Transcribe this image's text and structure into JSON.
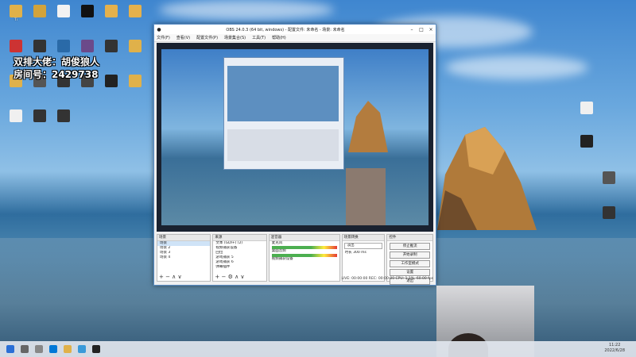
{
  "overlay": {
    "line1": "双排大佬：胡俊狼人",
    "line2": "房间号：2429738"
  },
  "desktop_icons": [
    {
      "label": "Ti",
      "color": "#e0b14a"
    },
    {
      "label": "",
      "color": "#d2a33b"
    },
    {
      "label": "",
      "color": "#f2f2f2"
    },
    {
      "label": "",
      "color": "#111111"
    },
    {
      "label": "",
      "color": "#e5b14c"
    },
    {
      "label": "",
      "color": "#e5b14c"
    },
    {
      "label": "",
      "color": "#cc3333"
    },
    {
      "label": "",
      "color": "#333333"
    },
    {
      "label": "",
      "color": "#2a6aa8"
    },
    {
      "label": "",
      "color": "#6b4a8a"
    },
    {
      "label": "",
      "color": "#333333"
    },
    {
      "label": "",
      "color": "#e0b14a"
    },
    {
      "label": "",
      "color": "#e0b14a"
    },
    {
      "label": "",
      "color": "#555555"
    },
    {
      "label": "",
      "color": "#333333"
    },
    {
      "label": "",
      "color": "#444444"
    },
    {
      "label": "",
      "color": "#222222"
    },
    {
      "label": "",
      "color": "#e0b14a"
    },
    {
      "label": "",
      "color": "#f0f0f0"
    },
    {
      "label": "",
      "color": "#333333"
    },
    {
      "label": "",
      "color": "#333333"
    }
  ],
  "right_icons": [
    {
      "label": "",
      "color": "#f0f0f0"
    },
    {
      "label": "",
      "color": "#222222"
    },
    {
      "label": "",
      "color": "#555555"
    },
    {
      "label": "",
      "color": "#333333"
    }
  ],
  "obs": {
    "title": "OBS 24.0.3 (64 bit, windows) - 配置文件: 未命名 - 场景: 未命名",
    "menu": [
      "文件(F)",
      "查看(V)",
      "配置文件(P)",
      "场景集合(S)",
      "工具(T)",
      "帮助(H)"
    ],
    "docks": {
      "scenes": {
        "title": "场景",
        "items": [
          "场景",
          "场景 2",
          "场景 3",
          "场景 4"
        ],
        "selected": 0
      },
      "sources": {
        "title": "来源",
        "items": [
          "文本 (GDI+) (2)",
          "视频捕获设备",
          "回位",
          "游戏捕获 5",
          "游戏捕获 6",
          "弹幕插件",
          "游戏捕获 7"
        ]
      },
      "mixer": {
        "title": "混音器",
        "tracks": [
          {
            "name": "麦克风",
            "db": "-4.6 dB"
          },
          {
            "name": "桌面音频",
            "db": "0.0 dB"
          },
          {
            "name": "视频捕获设备",
            "db": "0.0 dB"
          }
        ]
      },
      "transitions": {
        "title": "场景转换",
        "mode": "淡出",
        "duration_label": "时长",
        "duration": "300 ms"
      },
      "controls": {
        "title": "控件",
        "buttons": [
          "停止推流",
          "开始录制",
          "工作室模式",
          "设置",
          "退出"
        ]
      }
    },
    "status": "LIVE: 00:00:00   REC: 00:00:00   CPU: 1.1%, 60.00 fps"
  },
  "taskbar": {
    "time": "11:22",
    "date": "2022/6/28"
  }
}
